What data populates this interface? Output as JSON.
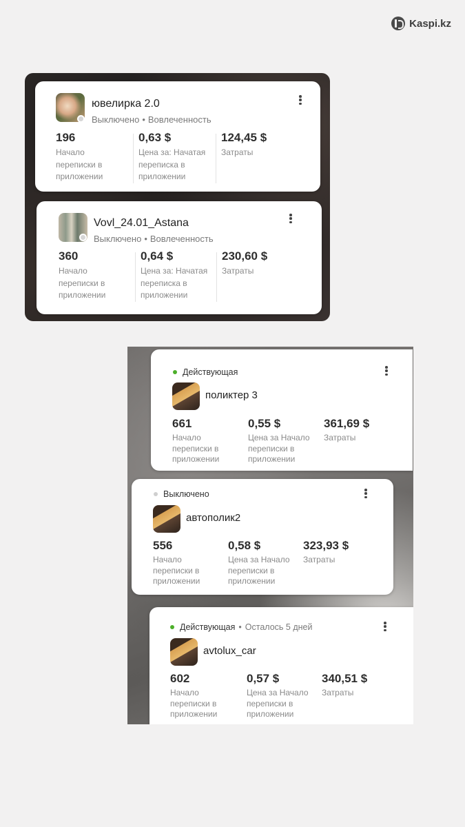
{
  "brand": {
    "name": "Kaspi.kz",
    "icon": "kaspi-logo-icon"
  },
  "colors": {
    "active": "#4caf2a",
    "inactive": "#cfcfcf",
    "value": "#2e2e2e",
    "label": "#8a8a8a"
  },
  "top_cards": [
    {
      "name": "ювелирка 2.0",
      "status": "Выключено",
      "objective": "Вовлеченность",
      "thumb_icon": "jewelry-thumbnail",
      "metrics": [
        {
          "value": "196",
          "label": "Начало переписки в приложении"
        },
        {
          "value": "0,63 $",
          "label": "Цена за: Начатая переписка в приложении"
        },
        {
          "value": "124,45 $",
          "label": "Затраты"
        }
      ]
    },
    {
      "name": "Vovl_24.01_Astana",
      "status": "Выключено",
      "objective": "Вовлеченность",
      "thumb_icon": "astana-thumbnail",
      "metrics": [
        {
          "value": "360",
          "label": "Начало переписки в приложении"
        },
        {
          "value": "0,64 $",
          "label": "Цена за: Начатая переписка в приложении"
        },
        {
          "value": "230,60 $",
          "label": "Затраты"
        }
      ]
    }
  ],
  "bottom_cards": [
    {
      "status": "Действующая",
      "status_color": "green",
      "extra": "",
      "name": "поликтер 3",
      "thumb_icon": "car-polish-thumbnail",
      "metrics": [
        {
          "value": "661",
          "label": "Начало переписки в приложении"
        },
        {
          "value": "0,55 $",
          "label": "Цена за Начало переписки в приложении"
        },
        {
          "value": "361,69 $",
          "label": "Затраты"
        }
      ]
    },
    {
      "status": "Выключено",
      "status_color": "grey",
      "extra": "",
      "name": "автополик2",
      "thumb_icon": "car-polish-thumbnail",
      "metrics": [
        {
          "value": "556",
          "label": "Начало переписки в приложении"
        },
        {
          "value": "0,58 $",
          "label": "Цена за Начало переписки в приложении"
        },
        {
          "value": "323,93 $",
          "label": "Затраты"
        }
      ]
    },
    {
      "status": "Действующая",
      "status_color": "green",
      "extra": "Осталось 5 дней",
      "name": "avtolux_car",
      "thumb_icon": "car-polish-thumbnail",
      "metrics": [
        {
          "value": "602",
          "label": "Начало переписки в приложении"
        },
        {
          "value": "0,57 $",
          "label": "Цена за Начало переписки в приложении"
        },
        {
          "value": "340,51 $",
          "label": "Затраты"
        }
      ]
    }
  ]
}
